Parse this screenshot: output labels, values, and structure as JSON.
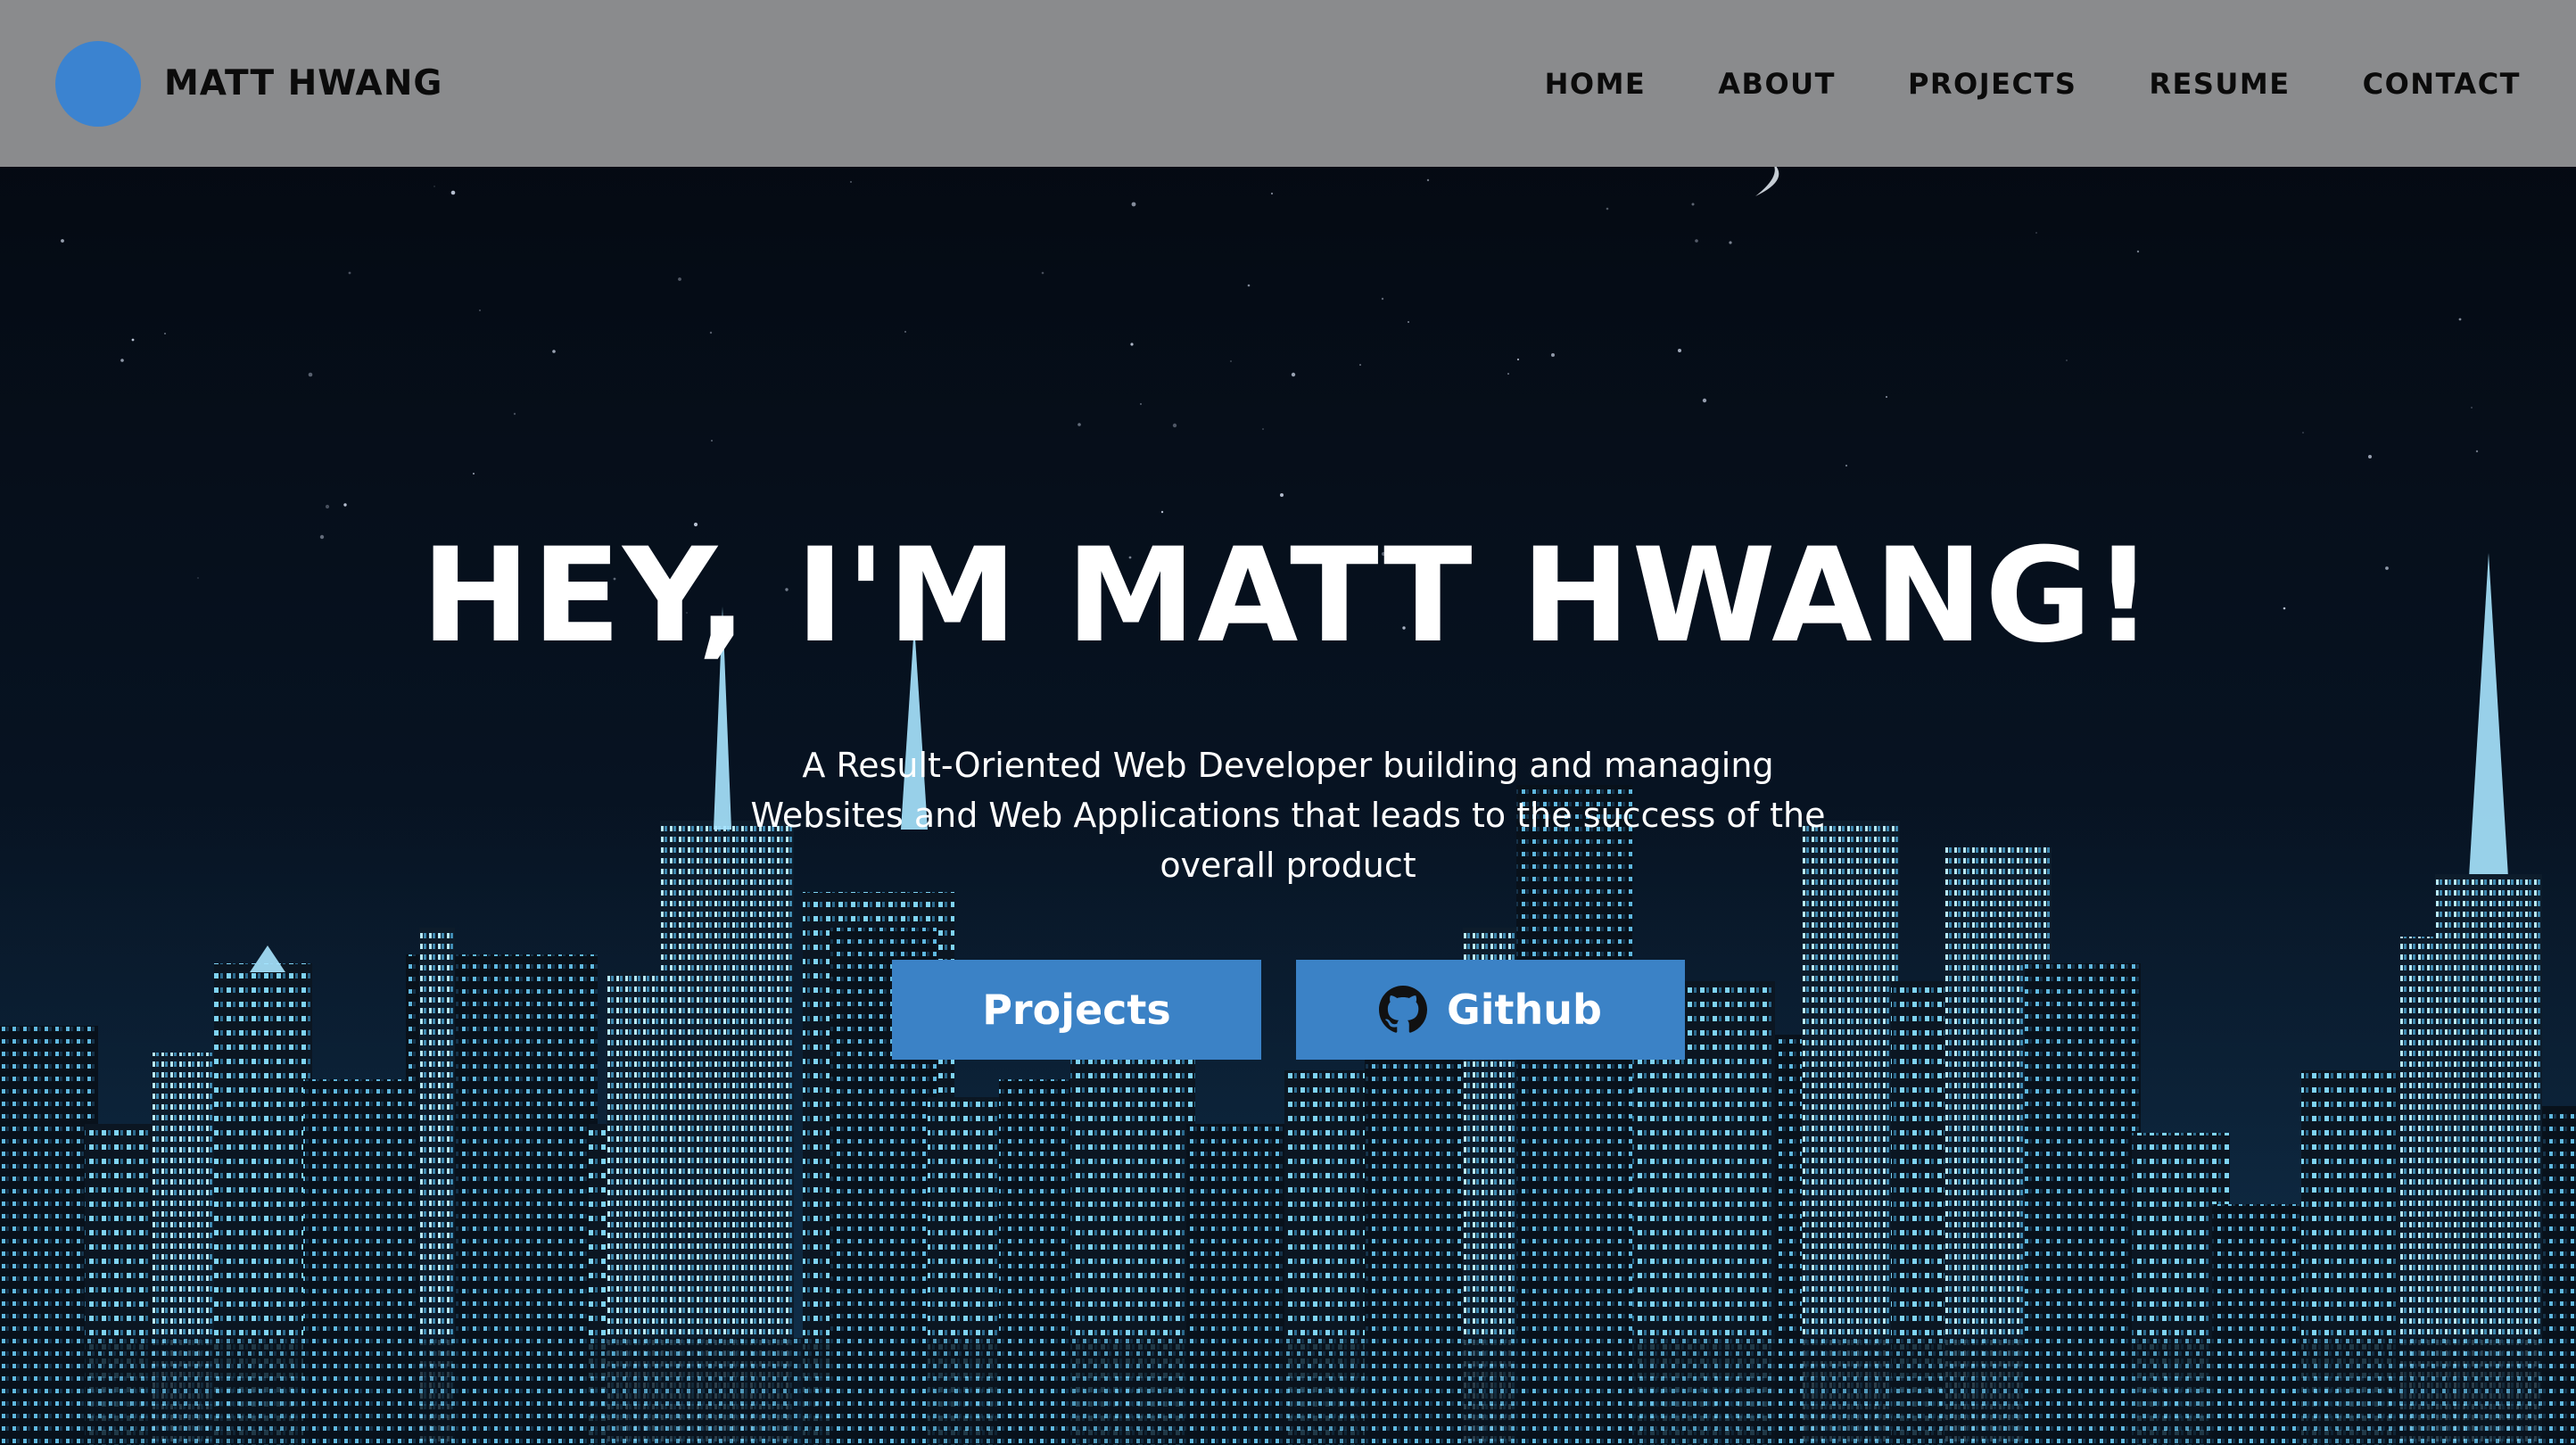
{
  "header": {
    "brand_name": "MATT HWANG",
    "nav": [
      "HOME",
      "ABOUT",
      "PROJECTS",
      "RESUME",
      "CONTACT"
    ]
  },
  "hero": {
    "title": "HEY, I'M MATT HWANG!",
    "subtitle": "A Result-Oriented Web Developer building and managing Websites and Web Applications that leads to the success of the overall product",
    "buttons": {
      "projects": "Projects",
      "github": "Github"
    }
  },
  "icons": {
    "brand_logo": "avatar-circle",
    "github": "github-icon"
  },
  "colors": {
    "header_bg": "#8a8b8d",
    "brand_accent": "#3b83d0",
    "button_bg": "#3b82c6",
    "sky": "#050b14",
    "text_light": "#ffffff",
    "text_dark": "#0b0b0b"
  }
}
